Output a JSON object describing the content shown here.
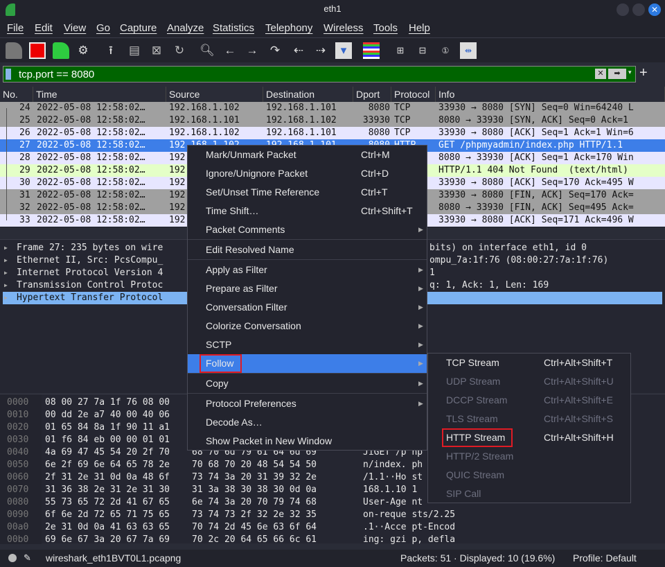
{
  "window": {
    "title": "eth1"
  },
  "menubar": [
    "File",
    "Edit",
    "View",
    "Go",
    "Capture",
    "Analyze",
    "Statistics",
    "Telephony",
    "Wireless",
    "Tools",
    "Help"
  ],
  "filter": {
    "value": "tcp.port == 8080",
    "plus": "+"
  },
  "columns": [
    "No.",
    "Time",
    "Source",
    "Destination",
    "Dport",
    "Protocol",
    "Info"
  ],
  "packets": [
    {
      "no": "24",
      "time": "2022-05-08 12:58:02…",
      "src": "192.168.1.102",
      "dst": "192.168.1.101",
      "dport": "8080",
      "proto": "TCP",
      "info": "33930 → 8080 [SYN] Seq=0 Win=64240 L",
      "bg": "#a0a0a0",
      "fg": "#111"
    },
    {
      "no": "25",
      "time": "2022-05-08 12:58:02…",
      "src": "192.168.1.101",
      "dst": "192.168.1.102",
      "dport": "33930",
      "proto": "TCP",
      "info": "8080 → 33930 [SYN, ACK] Seq=0 Ack=1",
      "bg": "#a0a0a0",
      "fg": "#111"
    },
    {
      "no": "26",
      "time": "2022-05-08 12:58:02…",
      "src": "192.168.1.102",
      "dst": "192.168.1.101",
      "dport": "8080",
      "proto": "TCP",
      "info": "33930 → 8080 [ACK] Seq=1 Ack=1 Win=6",
      "bg": "#e7e6ff",
      "fg": "#111"
    },
    {
      "no": "27",
      "time": "2022-05-08 12:58:02…",
      "src": "192.168.1.102",
      "dst": "192.168.1.101",
      "dport": "8080",
      "proto": "HTTP",
      "info": "GET /phpmyadmin/index.php HTTP/1.1",
      "bg": "#3d7ee8",
      "fg": "#ffffff"
    },
    {
      "no": "28",
      "time": "2022-05-08 12:58:02…",
      "src": "192",
      "dst": "",
      "dport": "",
      "proto": "",
      "info": "8080 → 33930 [ACK] Seq=1 Ack=170 Win",
      "bg": "#e7e6ff",
      "fg": "#111"
    },
    {
      "no": "29",
      "time": "2022-05-08 12:58:02…",
      "src": "192",
      "dst": "",
      "dport": "",
      "proto": "",
      "info": "HTTP/1.1 404 Not Found  (text/html)",
      "bg": "#e4ffc7",
      "fg": "#111"
    },
    {
      "no": "30",
      "time": "2022-05-08 12:58:02…",
      "src": "192",
      "dst": "",
      "dport": "",
      "proto": "",
      "info": "33930 → 8080 [ACK] Seq=170 Ack=495 W",
      "bg": "#e7e6ff",
      "fg": "#111"
    },
    {
      "no": "31",
      "time": "2022-05-08 12:58:02…",
      "src": "192",
      "dst": "",
      "dport": "",
      "proto": "",
      "info": "33930 → 8080 [FIN, ACK] Seq=170 Ack=",
      "bg": "#a0a0a0",
      "fg": "#111"
    },
    {
      "no": "32",
      "time": "2022-05-08 12:58:02…",
      "src": "192",
      "dst": "",
      "dport": "",
      "proto": "",
      "info": "8080 → 33930 [FIN, ACK] Seq=495 Ack=",
      "bg": "#a0a0a0",
      "fg": "#111"
    },
    {
      "no": "33",
      "time": "2022-05-08 12:58:02…",
      "src": "192",
      "dst": "",
      "dport": "",
      "proto": "",
      "info": "33930 → 8080 [ACK] Seq=171 Ack=496 W",
      "bg": "#e7e6ff",
      "fg": "#111"
    }
  ],
  "details": [
    {
      "left": "Frame 27: 235 bytes on wire",
      "right": "bits) on interface eth1, id 0"
    },
    {
      "left": "Ethernet II, Src: PcsCompu_",
      "right": "ompu_7a:1f:76 (08:00:27:7a:1f:76)"
    },
    {
      "left": "Internet Protocol Version 4",
      "right": "1"
    },
    {
      "left": "Transmission Control Protoc",
      "right": "q: 1, Ack: 1, Len: 169"
    },
    {
      "left": "Hypertext Transfer Protocol",
      "right": ""
    }
  ],
  "hex": [
    {
      "off": "0000",
      "a": "08 00 27 7a 1f 76 08 00",
      "b": "",
      "c": ""
    },
    {
      "off": "0010",
      "a": "00 dd 2e a7 40 00 40 06",
      "b": "",
      "c": ""
    },
    {
      "off": "0020",
      "a": "01 65 84 8a 1f 90 11 a1",
      "b": "",
      "c": ""
    },
    {
      "off": "0030",
      "a": "01 f6 84 eb 00 00 01 01",
      "b": "",
      "c": ""
    },
    {
      "off": "0040",
      "a": "4a 69 47 45 54 20 2f 70",
      "b": "68 70 6d 79 61 64 6d 69",
      "c": "JiGET /p hp"
    },
    {
      "off": "0050",
      "a": "6e 2f 69 6e 64 65 78 2e",
      "b": "70 68 70 20 48 54 54 50",
      "c": "n/index. ph"
    },
    {
      "off": "0060",
      "a": "2f 31 2e 31 0d 0a 48 6f",
      "b": "73 74 3a 20 31 39 32 2e",
      "c": "/1.1··Ho st"
    },
    {
      "off": "0070",
      "a": "31 36 38 2e 31 2e 31 30",
      "b": "31 3a 38 30 38 30 0d 0a",
      "c": "168.1.10 1"
    },
    {
      "off": "0080",
      "a": "55 73 65 72 2d 41 67 65",
      "b": "6e 74 3a 20 70 79 74 68",
      "c": "User-Age nt"
    },
    {
      "off": "0090",
      "a": "6f 6e 2d 72 65 71 75 65",
      "b": "73 74 73 2f 32 2e 32 35",
      "c": "on-reque sts/2.25"
    },
    {
      "off": "00a0",
      "a": "2e 31 0d 0a 41 63 63 65",
      "b": "70 74 2d 45 6e 63 6f 64",
      "c": ".1··Acce pt-Encod"
    },
    {
      "off": "00b0",
      "a": "69 6e 67 3a 20 67 7a 69",
      "b": "70 2c 20 64 65 66 6c 61",
      "c": "ing: gzi p, defla"
    }
  ],
  "context_menu": [
    {
      "label": "Mark/Unmark Packet",
      "shortcut": "Ctrl+M"
    },
    {
      "label": "Ignore/Unignore Packet",
      "shortcut": "Ctrl+D"
    },
    {
      "label": "Set/Unset Time Reference",
      "shortcut": "Ctrl+T"
    },
    {
      "label": "Time Shift…",
      "shortcut": "Ctrl+Shift+T"
    },
    {
      "label": "Packet Comments",
      "submenu": true
    },
    {
      "label": "Edit Resolved Name"
    },
    {
      "label": "Apply as Filter",
      "submenu": true
    },
    {
      "label": "Prepare as Filter",
      "submenu": true
    },
    {
      "label": "Conversation Filter",
      "submenu": true
    },
    {
      "label": "Colorize Conversation",
      "submenu": true
    },
    {
      "label": "SCTP",
      "submenu": true
    },
    {
      "label": "Follow",
      "submenu": true,
      "active": true
    },
    {
      "label": "Copy",
      "submenu": true
    },
    {
      "label": "Protocol Preferences",
      "submenu": true
    },
    {
      "label": "Decode As…"
    },
    {
      "label": "Show Packet in New Window"
    }
  ],
  "follow_submenu": [
    {
      "label": "TCP Stream",
      "shortcut": "Ctrl+Alt+Shift+T",
      "enabled": true
    },
    {
      "label": "UDP Stream",
      "shortcut": "Ctrl+Alt+Shift+U",
      "enabled": false
    },
    {
      "label": "DCCP Stream",
      "shortcut": "Ctrl+Alt+Shift+E",
      "enabled": false
    },
    {
      "label": "TLS Stream",
      "shortcut": "Ctrl+Alt+Shift+S",
      "enabled": false
    },
    {
      "label": "HTTP Stream",
      "shortcut": "Ctrl+Alt+Shift+H",
      "enabled": true,
      "highlighted": true
    },
    {
      "label": "HTTP/2 Stream",
      "enabled": false
    },
    {
      "label": "QUIC Stream",
      "enabled": false
    },
    {
      "label": "SIP Call",
      "enabled": false
    }
  ],
  "status": {
    "file": "wireshark_eth1BVT0L1.pcapng",
    "packets": "Packets: 51 · Displayed: 10 (19.6%)",
    "profile": "Profile: Default"
  },
  "colors": {
    "accent": "#3d7ee8",
    "filter_valid": "#006400",
    "highlight_box": "#e01b24"
  }
}
